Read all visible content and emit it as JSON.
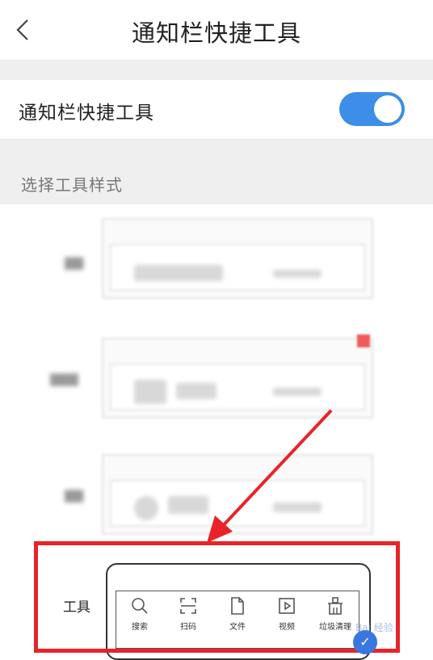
{
  "header": {
    "title": "通知栏快捷工具",
    "back_icon": "chevron-left-icon"
  },
  "toggle_row": {
    "label": "通知栏快捷工具",
    "enabled": true,
    "accent": "#3d8ee8"
  },
  "section": {
    "title": "选择工具样式"
  },
  "tools_option": {
    "label": "工具",
    "items": [
      {
        "icon": "search-icon",
        "label": "搜索"
      },
      {
        "icon": "scan-icon",
        "label": "扫码"
      },
      {
        "icon": "file-icon",
        "label": "文件"
      },
      {
        "icon": "video-icon",
        "label": "视频"
      },
      {
        "icon": "trash-icon",
        "label": "垃圾清理"
      }
    ]
  },
  "annotation": {
    "box_color": "#e8242a",
    "arrow_color": "#e8242a"
  },
  "watermark": {
    "text": "Bai 经验",
    "badge": "✓"
  }
}
